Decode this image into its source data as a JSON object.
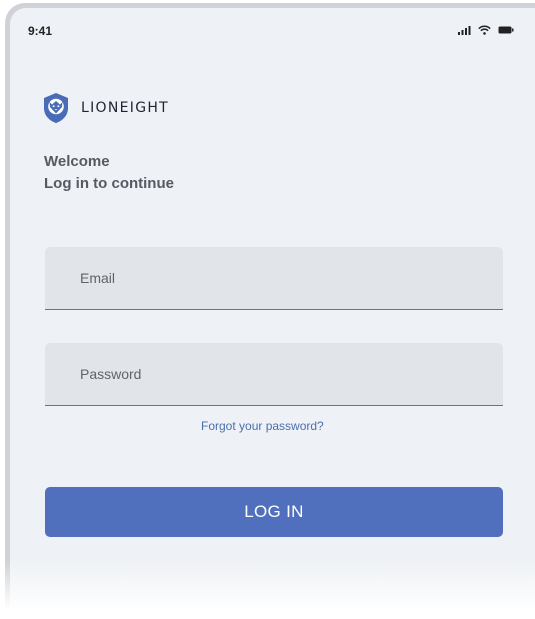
{
  "status_bar": {
    "time": "9:41",
    "icons": [
      "signal-icon",
      "wifi-icon",
      "battery-icon"
    ]
  },
  "brand": {
    "name": "LIONEIGHT",
    "logo_icon": "lion-shield-icon",
    "logo_color": "#4a6cb6"
  },
  "greeting": {
    "title": "Welcome",
    "subtitle": "Log in to continue"
  },
  "form": {
    "email_placeholder": "Email",
    "password_placeholder": "Password",
    "forgot_link": "Forgot your password?",
    "login_label": "LOG IN"
  },
  "colors": {
    "accent": "#5070be",
    "link": "#4a6fb0",
    "background": "#eef1f5",
    "field_background": "#e1e4e8"
  }
}
